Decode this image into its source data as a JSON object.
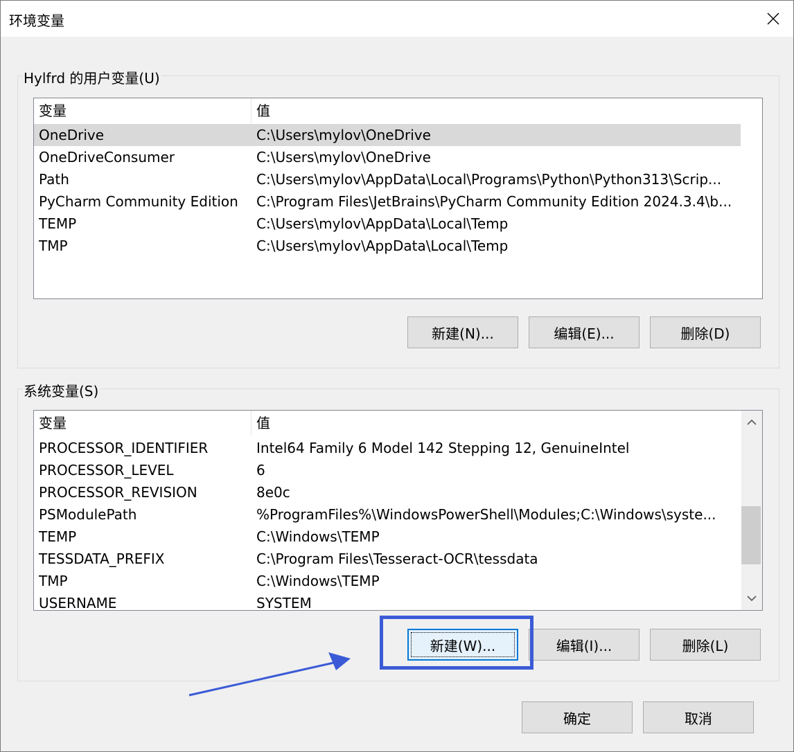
{
  "window": {
    "title": "环境变量"
  },
  "user_vars": {
    "label": "Hylfrd 的用户变量(U)",
    "header": {
      "name": "变量",
      "value": "值"
    },
    "rows": [
      {
        "name": "OneDrive",
        "value": "C:\\Users\\mylov\\OneDrive"
      },
      {
        "name": "OneDriveConsumer",
        "value": "C:\\Users\\mylov\\OneDrive"
      },
      {
        "name": "Path",
        "value": "C:\\Users\\mylov\\AppData\\Local\\Programs\\Python\\Python313\\Scrip..."
      },
      {
        "name": "PyCharm Community Edition",
        "value": "C:\\Program Files\\JetBrains\\PyCharm Community Edition 2024.3.4\\b..."
      },
      {
        "name": "TEMP",
        "value": "C:\\Users\\mylov\\AppData\\Local\\Temp"
      },
      {
        "name": "TMP",
        "value": "C:\\Users\\mylov\\AppData\\Local\\Temp"
      }
    ],
    "buttons": {
      "new": "新建(N)...",
      "edit": "编辑(E)...",
      "delete": "删除(D)"
    }
  },
  "system_vars": {
    "label": "系统变量(S)",
    "header": {
      "name": "变量",
      "value": "值"
    },
    "rows": [
      {
        "name": "PROCESSOR_IDENTIFIER",
        "value": "Intel64 Family 6 Model 142 Stepping 12, GenuineIntel"
      },
      {
        "name": "PROCESSOR_LEVEL",
        "value": "6"
      },
      {
        "name": "PROCESSOR_REVISION",
        "value": "8e0c"
      },
      {
        "name": "PSModulePath",
        "value": "%ProgramFiles%\\WindowsPowerShell\\Modules;C:\\Windows\\syste..."
      },
      {
        "name": "TEMP",
        "value": "C:\\Windows\\TEMP"
      },
      {
        "name": "TESSDATA_PREFIX",
        "value": "C:\\Program Files\\Tesseract-OCR\\tessdata"
      },
      {
        "name": "TMP",
        "value": "C:\\Windows\\TEMP"
      },
      {
        "name": "USERNAME",
        "value": "SYSTEM"
      }
    ],
    "buttons": {
      "new": "新建(W)...",
      "edit": "编辑(I)...",
      "delete": "删除(L)"
    }
  },
  "footer": {
    "ok": "确定",
    "cancel": "取消"
  },
  "icons": {
    "close": "close-icon",
    "scroll_up": "chevron-up-icon",
    "scroll_down": "chevron-down-icon"
  },
  "colors": {
    "annotation": "#3b5bd6",
    "selected_row": "#d9d9d9",
    "default_button_border": "#0078d7"
  }
}
